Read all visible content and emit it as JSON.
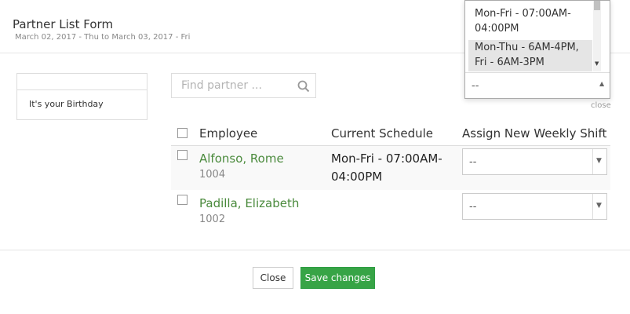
{
  "modal": {
    "title": "Partner List Form",
    "subtitle": "March 02, 2017 - Thu to March 03, 2017 - Fri"
  },
  "sidebar": {
    "items": [
      {
        "label": "It's your Birthday"
      }
    ]
  },
  "search": {
    "placeholder": "Find partner ..."
  },
  "close_link": "close",
  "table": {
    "headers": {
      "employee": "Employee",
      "current_schedule": "Current Schedule",
      "assign_new_weekly_shift": "Assign New Weekly Shift"
    },
    "rows": [
      {
        "name": "Alfonso, Rome",
        "id": "1004",
        "schedule": "Mon-Fri - 07:00AM-04:00PM",
        "shift_value": "--"
      },
      {
        "name": "Padilla, Elizabeth",
        "id": "1002",
        "schedule": "",
        "shift_value": "--"
      }
    ]
  },
  "shift_dropdown": {
    "options": [
      {
        "label": "Mon-Fri - 07:00AM-04:00PM",
        "highlighted": false
      },
      {
        "label": "Mon-Thu - 6AM-4PM, Fri - 6AM-3PM",
        "highlighted": true
      }
    ],
    "selected_value": "--"
  },
  "footer": {
    "close_label": "Close",
    "save_label": "Save changes"
  },
  "colors": {
    "employee_link": "#4a8a3c",
    "primary_button": "#37a446",
    "highlight_option": "#e5e5e5"
  }
}
